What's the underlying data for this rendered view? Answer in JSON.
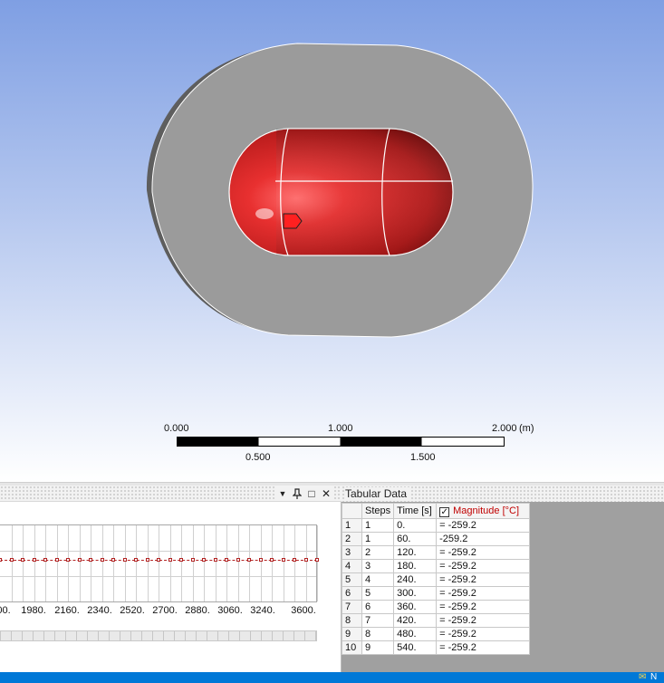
{
  "viewport": {
    "scale_bar": {
      "top_labels": [
        "0.000",
        "1.000",
        "2.000"
      ],
      "bottom_labels": [
        "0.500",
        "1.500"
      ],
      "unit": "(m)"
    }
  },
  "graph_panel": {
    "x_ticks": [
      "00.",
      "1980.",
      "2160.",
      "2340.",
      "2520.",
      "2700.",
      "2880.",
      "3060.",
      "3240.",
      "3600."
    ],
    "series_color": "#b22222",
    "buttons": {
      "dropdown": "▼",
      "pin": "📌",
      "maximize": "□",
      "close": "✕"
    }
  },
  "tabular_data": {
    "title": "Tabular Data",
    "headers": {
      "steps": "Steps",
      "time": "Time [s]",
      "magnitude": "Magnitude [°C]"
    },
    "rows": [
      {
        "n": "1",
        "step": "1",
        "time": "0.",
        "value": "= -259.2"
      },
      {
        "n": "2",
        "step": "1",
        "time": "60.",
        "value": "-259.2"
      },
      {
        "n": "3",
        "step": "2",
        "time": "120.",
        "value": "= -259.2"
      },
      {
        "n": "4",
        "step": "3",
        "time": "180.",
        "value": "= -259.2"
      },
      {
        "n": "5",
        "step": "4",
        "time": "240.",
        "value": "= -259.2"
      },
      {
        "n": "6",
        "step": "5",
        "time": "300.",
        "value": "= -259.2"
      },
      {
        "n": "7",
        "step": "6",
        "time": "360.",
        "value": "= -259.2"
      },
      {
        "n": "8",
        "step": "7",
        "time": "420.",
        "value": "= -259.2"
      },
      {
        "n": "9",
        "step": "8",
        "time": "480.",
        "value": "= -259.2"
      },
      {
        "n": "10",
        "step": "9",
        "time": "540.",
        "value": "= -259.2"
      }
    ]
  },
  "status_bar": {
    "text": "N"
  }
}
